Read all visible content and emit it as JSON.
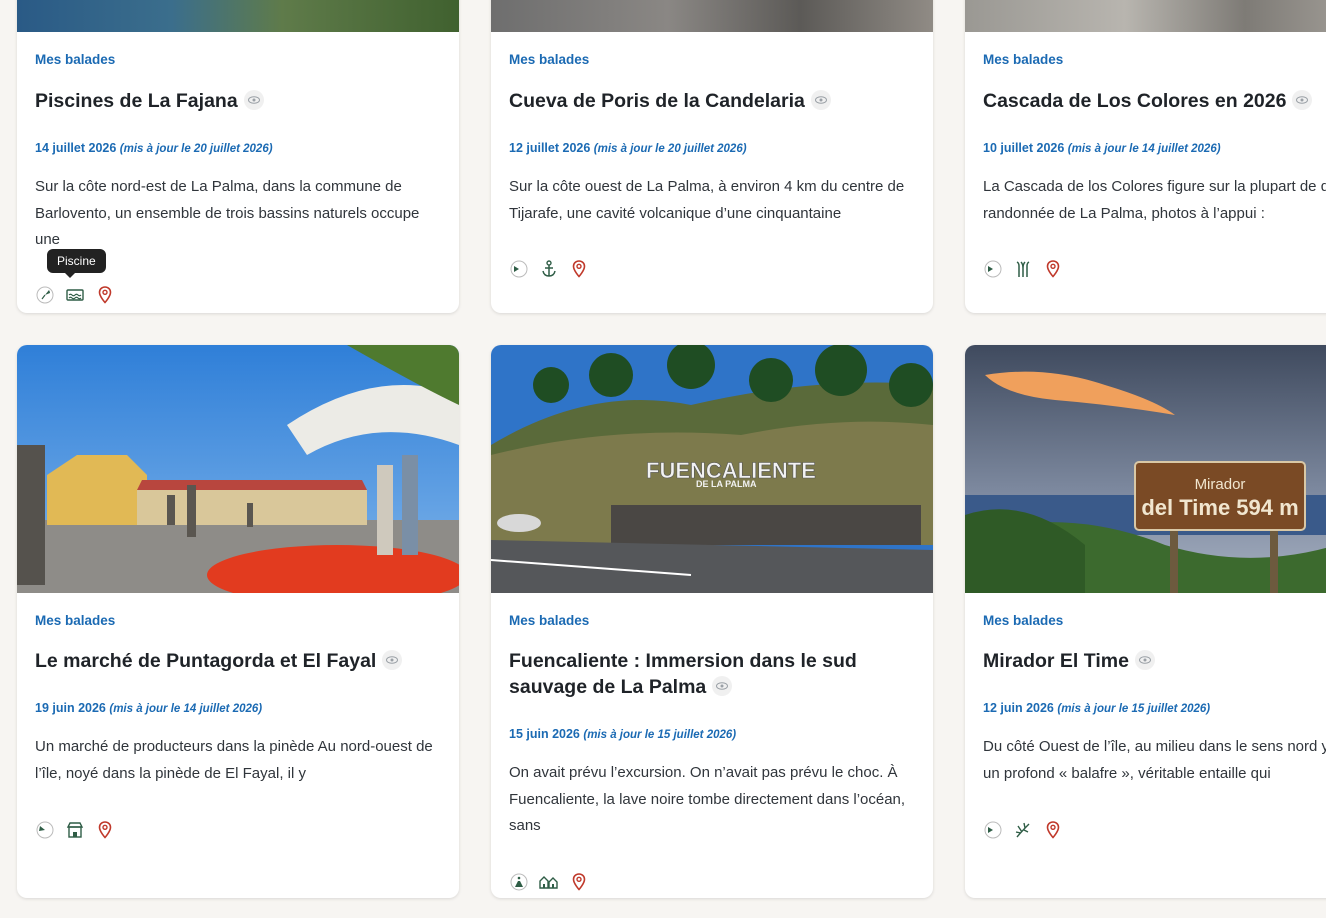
{
  "cards": [
    {
      "category": "Mes balades",
      "title": "Piscines de La Fajana",
      "date": "14 juillet 2026",
      "updated": "(mis à jour le 20 juillet 2026)",
      "excerpt": "Sur la côte nord-est de La Palma, dans la commune de Barlovento, un ensemble de trois bassins naturels occupe une",
      "tooltip": "Piscine",
      "icons": [
        "difficulty-easy-icon",
        "pool-icon",
        "map-pin-icon"
      ]
    },
    {
      "category": "Mes balades",
      "title": "Cueva de Poris de la Candelaria",
      "date": "12 juillet 2026",
      "updated": "(mis à jour le 20 juillet 2026)",
      "excerpt": "Sur la côte ouest de La Palma, à environ 4 km du centre de Tijarafe, une cavité volcanique d’une cinquantaine",
      "icons": [
        "difficulty-icon",
        "anchor-icon",
        "map-pin-icon"
      ]
    },
    {
      "category": "Mes balades",
      "title": "Cascada de Los Colores en 2026",
      "date": "10 juillet 2026",
      "updated": "(mis à jour le 14 juillet 2026)",
      "excerpt": "La Cascada de los Colores figure sur la plupart de de randonnée de La Palma, photos à l’appui :",
      "icons": [
        "difficulty-icon",
        "plant-icon",
        "map-pin-icon"
      ]
    },
    {
      "category": "Mes balades",
      "title": "Le marché de Puntagorda et El Fayal",
      "date": "19 juin 2026",
      "updated": "(mis à jour le 14 juillet 2026)",
      "excerpt": "Un marché de producteurs dans la pinède Au nord-ouest de l’île, noyé dans la pinède de El Fayal, il y",
      "icons": [
        "difficulty-icon",
        "market-icon",
        "map-pin-icon"
      ]
    },
    {
      "category": "Mes balades",
      "title": "Fuencaliente : Immersion dans le sud sauvage de La Palma",
      "date": "15 juin 2026",
      "updated": "(mis à jour le 15 juillet 2026)",
      "excerpt": "On avait prévu l’excursion. On n’avait pas prévu le choc. À Fuencaliente, la lave noire tombe directement dans l’océan, sans",
      "icons": [
        "volcano-icon",
        "village-icon",
        "map-pin-icon"
      ]
    },
    {
      "category": "Mes balades",
      "title": "Mirador El Time",
      "date": "12 juin 2026",
      "updated": "(mis à jour le 15 juillet 2026)",
      "excerpt": "Du côté Ouest de l’île, au milieu dans le sens nord y a un profond « balafre », véritable entaille qui",
      "icons": [
        "difficulty-icon",
        "palm-icon",
        "map-pin-icon"
      ]
    }
  ],
  "photo_text": {
    "fuencaliente_sign": "FUENCALIENTE",
    "fuencaliente_sub": "DE LA PALMA",
    "mirador_line1": "Mirador",
    "mirador_line2": "del Time 594 m"
  },
  "colors": {
    "accent": "#1b6ab3",
    "icon_green": "#2f5d46",
    "pin_red": "#c0392b",
    "background": "#f7f5f2"
  }
}
